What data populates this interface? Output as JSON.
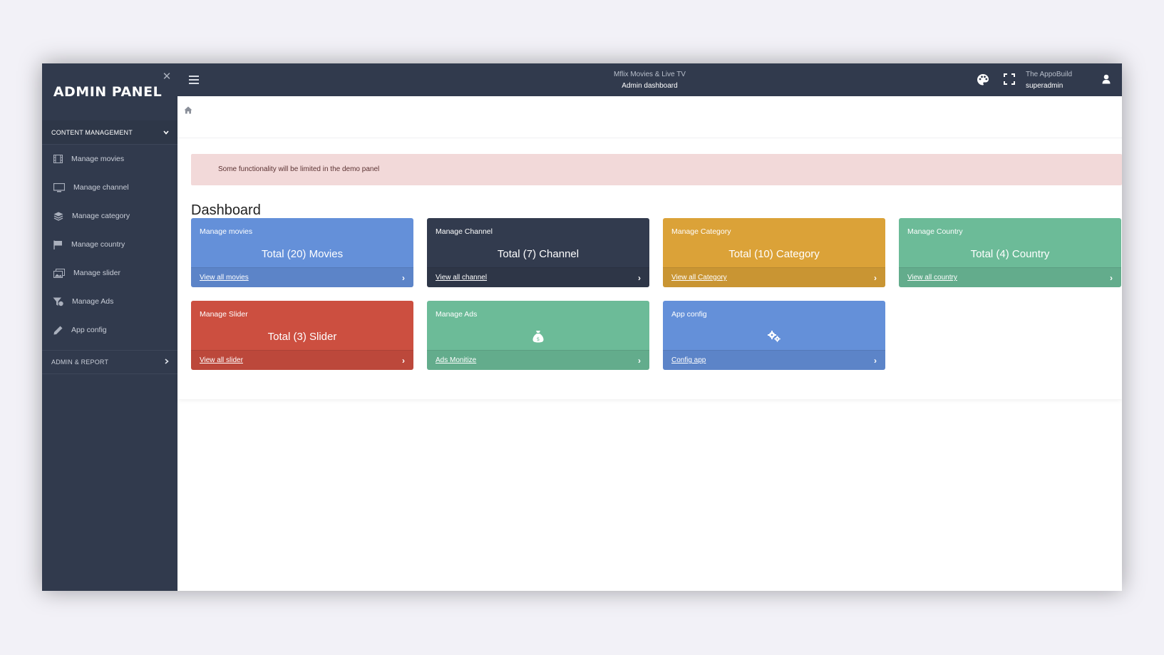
{
  "sidebar": {
    "brand": "ADMIN PANEL",
    "close_label": "✕",
    "section_primary": "CONTENT MANAGEMENT",
    "section_secondary": "ADMIN & REPORT",
    "items": [
      {
        "label": "Manage movies",
        "icon": "film-icon"
      },
      {
        "label": "Manage channel",
        "icon": "monitor-icon"
      },
      {
        "label": "Manage category",
        "icon": "layers-icon"
      },
      {
        "label": "Manage country",
        "icon": "flag-icon"
      },
      {
        "label": "Manage slider",
        "icon": "images-icon"
      },
      {
        "label": "Manage Ads",
        "icon": "funnel-dollar-icon"
      },
      {
        "label": "App config",
        "icon": "pencil-icon"
      }
    ]
  },
  "topbar": {
    "app_name": "Mflix Movies & Live TV",
    "page_name": "Admin dashboard",
    "user_org": "The AppoBuild",
    "user_name": "superadmin"
  },
  "alert": {
    "text": "Some functionality will be limited in the demo panel"
  },
  "dashboard": {
    "title": "Dashboard",
    "cards": [
      {
        "title": "Manage movies",
        "total": "Total (20) Movies",
        "link": "View all movies",
        "color": "#6490d9"
      },
      {
        "title": "Manage Channel",
        "total": "Total (7) Channel",
        "link": "View all channel",
        "color": "#323b4e"
      },
      {
        "title": "Manage Category",
        "total": "Total (10) Category",
        "link": "View all Category",
        "color": "#dba238"
      },
      {
        "title": "Manage Country",
        "total": "Total (4) Country",
        "link": "View all country",
        "color": "#6cbb98"
      },
      {
        "title": "Manage Slider",
        "total": "Total (3) Slider",
        "link": "View all slider",
        "color": "#cc4f40"
      },
      {
        "title": "Manage Ads",
        "icon": "money-bag-icon",
        "link": "Ads Monitize",
        "color": "#6cbb98"
      },
      {
        "title": "App config",
        "icon": "gears-icon",
        "link": "Config app",
        "color": "#6490d9"
      }
    ]
  },
  "colors": {
    "sidebar_bg": "#313a4d",
    "alert_bg": "#f2d9d9",
    "page_bg": "#f2f1f7"
  }
}
